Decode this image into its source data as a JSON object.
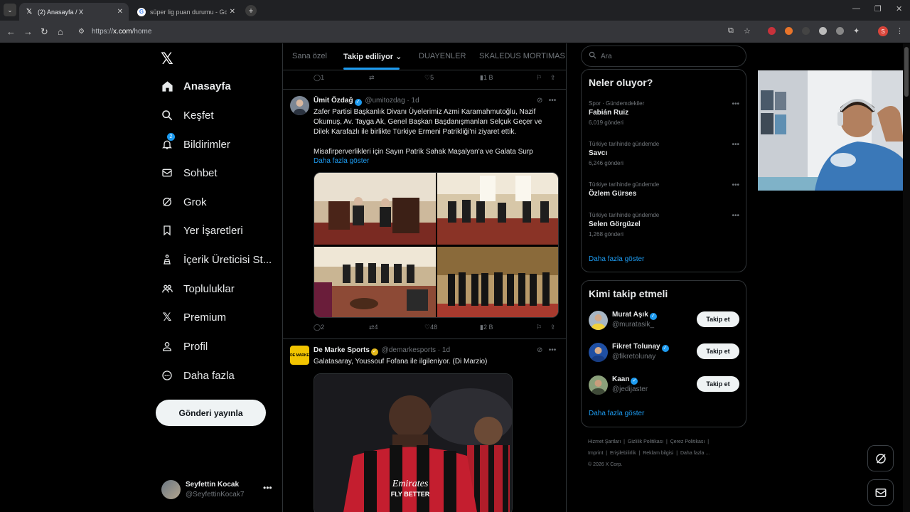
{
  "browser": {
    "tabs": [
      {
        "title": "(2) Anasayfa / X",
        "active": true
      },
      {
        "title": "süper lig puan durumu - Google",
        "active": false
      }
    ],
    "url_prefix": "https://",
    "url_domain": "x.com",
    "url_path": "/home",
    "profile_initial": "S"
  },
  "sidebar": {
    "items": [
      {
        "label": "Anasayfa",
        "icon": "home-icon"
      },
      {
        "label": "Keşfet",
        "icon": "search-icon"
      },
      {
        "label": "Bildirimler",
        "icon": "bell-icon",
        "badge": "2"
      },
      {
        "label": "Sohbet",
        "icon": "mail-icon"
      },
      {
        "label": "Grok",
        "icon": "grok-icon"
      },
      {
        "label": "Yer İşaretleri",
        "icon": "bookmark-icon"
      },
      {
        "label": "İçerik Üreticisi St...",
        "icon": "creator-studio-icon"
      },
      {
        "label": "Topluluklar",
        "icon": "communities-icon"
      },
      {
        "label": "Premium",
        "icon": "x-premium-icon"
      },
      {
        "label": "Profil",
        "icon": "profile-icon"
      },
      {
        "label": "Daha fazla",
        "icon": "more-circle-icon"
      }
    ],
    "post_button": "Gönderi yayınla",
    "account": {
      "name": "Seyfettin Kocak",
      "handle": "@SeyfettinKocak7"
    }
  },
  "feed": {
    "tabs": [
      "Sana özel",
      "Takip ediliyor",
      "DUAYENLER",
      "SKALEDUS MORTIMAS"
    ],
    "prev_actions": {
      "replies": "1",
      "reposts": "",
      "likes": "5",
      "views": "1 B"
    },
    "tweet1": {
      "name": "Ümit Özdağ",
      "handle": "@umitozdag",
      "time": "· 1d",
      "text1": "Zafer Partisi Başkanlık Divanı Üyelerimiz Azmi Karamahmutoğlu, Nazif Okumuş, Av. Tayga Ak, Genel Başkan Başdanışmanları Selçuk Geçer ve Dilek Karafazlı ile birlikte Türkiye Ermeni Patrikliği'ni ziyaret ettik.",
      "text2": "Misafirperverlikleri için Sayın Patrik Sahak Maşalyan'a ve Galata Surp",
      "show_more": "Daha fazla göster",
      "actions": {
        "replies": "2",
        "reposts": "4",
        "likes": "48",
        "views": "2 B"
      }
    },
    "tweet2": {
      "name": "De Marke Sports",
      "handle": "@demarkesports",
      "time": "· 1d",
      "avatar_text": "DE MARKE",
      "text": "Galatasaray, Youssouf Fofana ile ilgileniyor. (Di Marzio)",
      "jersey_text": "Emirates FLY BETTER"
    }
  },
  "right": {
    "search_placeholder": "Ara",
    "trends_title": "Neler oluyor?",
    "trends": [
      {
        "category": "Spor · Gündemdekiler",
        "name": "Fabián Ruiz",
        "count": "6,019 gönderi"
      },
      {
        "category": "Türkiye tarihinde gündemde",
        "name": "Savcı",
        "count": "6,246 gönderi"
      },
      {
        "category": "Türkiye tarihinde gündemde",
        "name": "Özlem Gürses",
        "count": ""
      },
      {
        "category": "Türkiye tarihinde gündemde",
        "name": "Selen Görgüzel",
        "count": "1,268 gönderi"
      }
    ],
    "trends_more": "Daha fazla göster",
    "who_title": "Kimi takip etmeli",
    "who": [
      {
        "name": "Murat Aşık",
        "handle": "@muratasik_",
        "button": "Takip et"
      },
      {
        "name": "Fikret Tolunay",
        "handle": "@fikretolunay",
        "button": "Takip et"
      },
      {
        "name": "Kaan",
        "handle": "@jedijaster",
        "button": "Takip et"
      }
    ],
    "who_more": "Daha fazla göster",
    "footer": [
      "Hizmet Şartları",
      "Gizlilik Politikası",
      "Çerez Politikası",
      "Imprint",
      "Erişilebilirlik",
      "Reklam bilgisi",
      "Daha fazla ...",
      "© 2026 X Corp."
    ]
  },
  "colors": {
    "accent": "#1d9bf0",
    "background": "#000000",
    "border": "#2f3336",
    "muted": "#71767b"
  }
}
